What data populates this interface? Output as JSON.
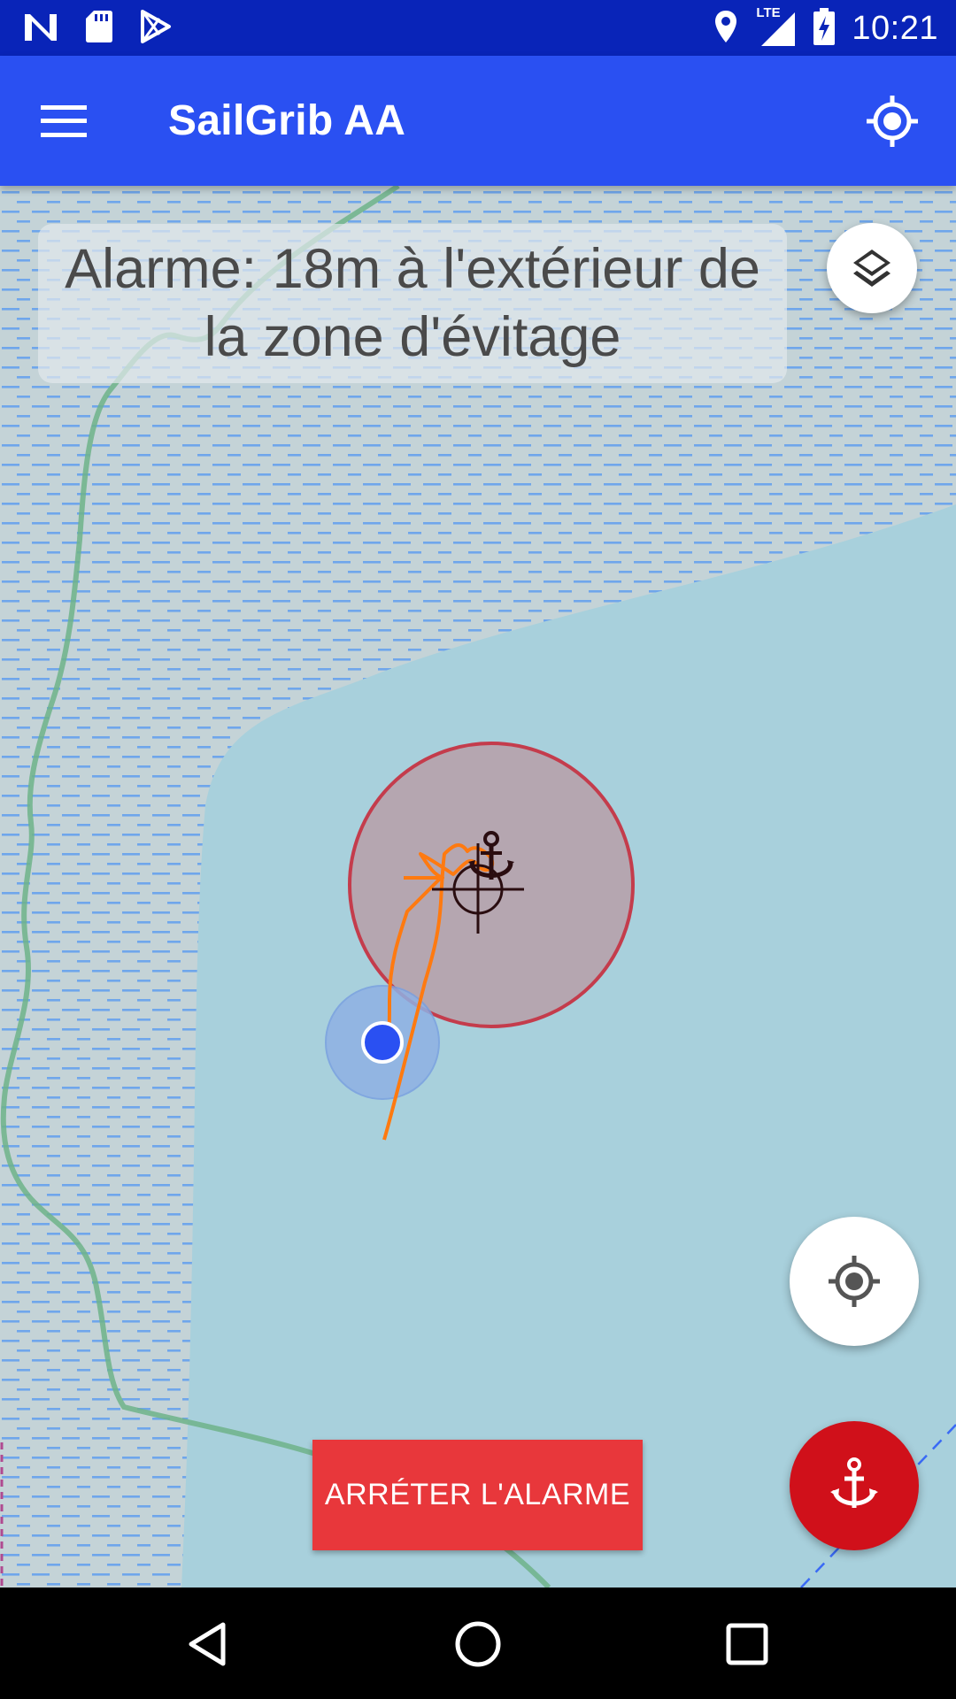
{
  "status_bar": {
    "time": "10:21",
    "network_label": "LTE",
    "icons": [
      "notification-n-icon",
      "sd-card-icon",
      "play-store-icon",
      "location-icon",
      "signal-icon",
      "battery-charging-icon"
    ]
  },
  "app_bar": {
    "title": "SailGrib AA",
    "left_icon": "menu-icon",
    "right_icon": "gps-locate-icon"
  },
  "alarm": {
    "message": "Alarme: 18m à l'extérieur de la zone d'évitage"
  },
  "buttons": {
    "stop_alarm_label": "ARRÉTER L'ALARME",
    "layers_icon": "layers-icon",
    "my_location_icon": "my-location-icon",
    "anchor_icon": "anchor-icon"
  },
  "colors": {
    "status_bar": "#0924b8",
    "app_bar": "#2a50f2",
    "stop_alarm": "#e8373b",
    "anchor_fab": "#d0101a",
    "water_deep": "#a8d0dc",
    "water_shallow": "#c4d4d8",
    "track": "#ff7a10",
    "swing_zone": "#c43c4c"
  },
  "nav_bar": {
    "icons": [
      "back-icon",
      "home-icon",
      "recents-icon"
    ]
  }
}
